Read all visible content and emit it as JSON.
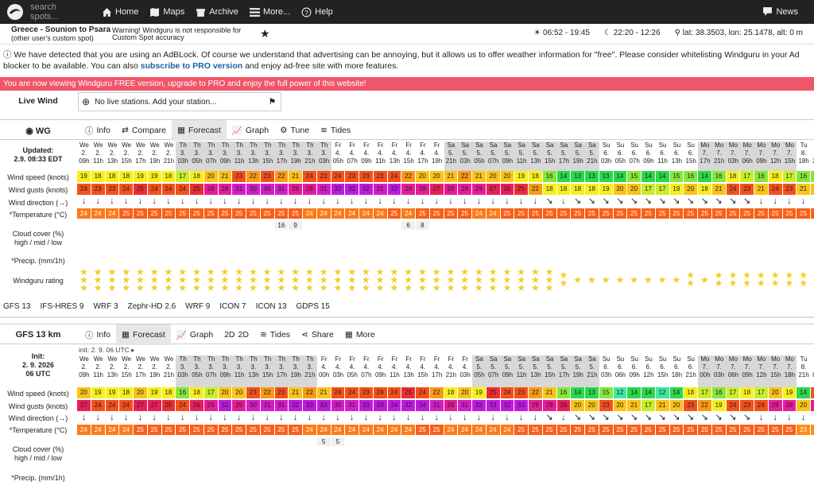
{
  "nav": {
    "search_placeholder": "search spots...",
    "home": "Home",
    "maps": "Maps",
    "archive": "Archive",
    "more": "More...",
    "help": "Help",
    "news": "News"
  },
  "spot": {
    "name": "Greece - Sounion to Psara",
    "note": "(other user's custom spot)",
    "warning": "Warning! Windguru is not responsible for Custom Spot accuracy",
    "sun": "06:52 - 19:45",
    "moon": "22:20 - 12:26",
    "coords": "lat: 38.3503, lon: 25.1478, alt: 0 m"
  },
  "adblock": {
    "text1": "We have detected that you are using an AdBLock. Of course we understand that advertising can be annoying, but it allows us to offer weather information for \"free\". Please consider whitelisting Windguru in your Ad blocker to be available. You can also ",
    "link": "subscribe to PRO version",
    "text2": " and enjoy ad-free site with more features."
  },
  "pro_banner": "You are now viewing Windguru FREE version, upgrade to PRO and enjoy the full power of this website!",
  "livewind": {
    "label": "Live Wind",
    "text": "No live stations. Add your station..."
  },
  "wg": {
    "title": "WG",
    "tabs": [
      "Info",
      "Compare",
      "Forecast",
      "Graph",
      "Tune",
      "Tides"
    ],
    "updated_label": "Updated:",
    "updated_value": "2.9. 08:33 EDT",
    "labels": {
      "speed": "Wind speed (knots)",
      "gusts": "Wind gusts (knots)",
      "dir": "Wind direction (→)",
      "temp": "*Temperature (°C)",
      "cloud": "Cloud cover (%)",
      "cloud2": "high / mid / low",
      "precip": "*Precip. (mm/1h)",
      "rating": "Windguru rating"
    },
    "days": [
      "We",
      "We",
      "We",
      "We",
      "We",
      "We",
      "We",
      "Th",
      "Th",
      "Th",
      "Th",
      "Th",
      "Th",
      "Th",
      "Th",
      "Th",
      "Th",
      "Th",
      "Fr",
      "Fr",
      "Fr",
      "Fr",
      "Fr",
      "Fr",
      "Fr",
      "Fr",
      "Sa",
      "Sa",
      "Sa",
      "Sa",
      "Sa",
      "Sa",
      "Sa",
      "Sa",
      "Sa",
      "Sa",
      "Sa",
      "Su",
      "Su",
      "Su",
      "Su",
      "Su",
      "Su",
      "Su",
      "Mo",
      "Mo",
      "Mo",
      "Mo",
      "Mo",
      "Mo",
      "Mo",
      "Tu",
      "Tu"
    ],
    "dates": [
      "2.",
      "2.",
      "2.",
      "2.",
      "2.",
      "2.",
      "2.",
      "3.",
      "3.",
      "3.",
      "3.",
      "3.",
      "3.",
      "3.",
      "3.",
      "3.",
      "3.",
      "3.",
      "4.",
      "4.",
      "4.",
      "4.",
      "4.",
      "4.",
      "4.",
      "4.",
      "5.",
      "5.",
      "5.",
      "5.",
      "5.",
      "5.",
      "5.",
      "5.",
      "5.",
      "5.",
      "5.",
      "6.",
      "6.",
      "6.",
      "6.",
      "6.",
      "6.",
      "6.",
      "7.",
      "7.",
      "7.",
      "7.",
      "7.",
      "7.",
      "7.",
      "8.",
      "8."
    ],
    "hours": [
      "09h",
      "11h",
      "13h",
      "15h",
      "17h",
      "19h",
      "21h",
      "03h",
      "05h",
      "07h",
      "09h",
      "11h",
      "13h",
      "15h",
      "17h",
      "19h",
      "21h",
      "03h",
      "05h",
      "07h",
      "09h",
      "11h",
      "13h",
      "15h",
      "17h",
      "19h",
      "21h",
      "03h",
      "05h",
      "07h",
      "09h",
      "11h",
      "13h",
      "15h",
      "17h",
      "19h",
      "21h",
      "03h",
      "05h",
      "07h",
      "09h",
      "11h",
      "13h",
      "15h",
      "17h",
      "21h",
      "03h",
      "06h",
      "09h",
      "12h",
      "15h",
      "18h",
      "21h"
    ],
    "speed": [
      19,
      18,
      18,
      18,
      19,
      19,
      18,
      17,
      18,
      20,
      21,
      23,
      22,
      23,
      22,
      21,
      24,
      23,
      24,
      23,
      23,
      23,
      24,
      22,
      20,
      20,
      21,
      22,
      21,
      20,
      20,
      19,
      18,
      16,
      14,
      13,
      13,
      13,
      14,
      15,
      14,
      14,
      15,
      16,
      14,
      16,
      18,
      17,
      16,
      18,
      17,
      16,
      16
    ],
    "gusts": [
      24,
      23,
      23,
      24,
      25,
      24,
      24,
      24,
      25,
      28,
      28,
      31,
      30,
      30,
      31,
      29,
      28,
      31,
      32,
      32,
      32,
      31,
      32,
      29,
      28,
      27,
      28,
      29,
      29,
      27,
      26,
      25,
      22,
      18,
      18,
      18,
      18,
      19,
      20,
      20,
      17,
      17,
      19,
      20,
      18,
      21,
      24,
      23,
      21,
      24,
      23,
      21,
      21
    ],
    "temp": [
      24,
      24,
      24,
      25,
      25,
      25,
      25,
      25,
      25,
      25,
      25,
      25,
      25,
      25,
      25,
      25,
      24,
      24,
      24,
      24,
      24,
      24,
      25,
      24,
      25,
      25,
      25,
      25,
      24,
      24,
      25,
      25,
      25,
      25,
      25,
      25,
      25,
      25,
      25,
      25,
      25,
      25,
      25,
      25,
      25,
      25,
      25,
      25,
      25,
      25,
      25,
      25,
      25
    ],
    "cloud": [
      "",
      "",
      "",
      "",
      "",
      "",
      "",
      "",
      "",
      "",
      "",
      "",
      "",
      "",
      "16",
      "9",
      "",
      "",
      "",
      "",
      "",
      "",
      "",
      "6",
      "8",
      "",
      "",
      "",
      "",
      "",
      "",
      "",
      "",
      "",
      "",
      "",
      "",
      "",
      "",
      "",
      "",
      "",
      "",
      "",
      "",
      "",
      "",
      "",
      "",
      "",
      "",
      "",
      ""
    ],
    "rating": [
      3,
      3,
      3,
      3,
      3,
      3,
      3,
      3,
      3,
      3,
      3,
      3,
      3,
      3,
      3,
      3,
      3,
      3,
      3,
      3,
      3,
      3,
      3,
      3,
      3,
      3,
      3,
      3,
      3,
      3,
      3,
      3,
      3,
      3,
      2,
      1,
      1,
      1,
      1,
      1,
      1,
      1,
      1,
      2,
      1,
      2,
      2,
      2,
      2,
      2,
      2,
      2,
      2
    ]
  },
  "models": [
    "GFS 13",
    "IFS-HRES 9",
    "WRF 3",
    "Zephr-HD 2.6",
    "WRF 9",
    "ICON 7",
    "ICON 13",
    "GDPS 15"
  ],
  "gfs": {
    "title": "GFS 13 km",
    "tabs": [
      "Info",
      "Forecast",
      "Graph",
      "2D",
      "Tides",
      "Share",
      "More"
    ],
    "init_label": "Init:",
    "init_date": "2. 9. 2026",
    "init_time": "06 UTC",
    "init_line": "init: 2. 9. 06 UTC",
    "labels": {
      "speed": "Wind speed (knots)",
      "gusts": "Wind gusts (knots)",
      "dir": "Wind direction (→)",
      "temp": "*Temperature (°C)",
      "cloud": "Cloud cover (%)",
      "cloud2": "high / mid / low",
      "precip": "*Precip. (mm/1h)"
    },
    "days": [
      "We",
      "We",
      "We",
      "We",
      "We",
      "We",
      "We",
      "Th",
      "Th",
      "Th",
      "Th",
      "Th",
      "Th",
      "Th",
      "Th",
      "Th",
      "Th",
      "Fr",
      "Fr",
      "Fr",
      "Fr",
      "Fr",
      "Fr",
      "Fr",
      "Fr",
      "Fr",
      "Fr",
      "Fr",
      "Sa",
      "Sa",
      "Sa",
      "Sa",
      "Sa",
      "Sa",
      "Sa",
      "Sa",
      "Sa",
      "Su",
      "Su",
      "Su",
      "Su",
      "Su",
      "Su",
      "Su",
      "Mo",
      "Mo",
      "Mo",
      "Mo",
      "Mo",
      "Mo",
      "Mo",
      "Tu",
      "Tu"
    ],
    "dates": [
      "2.",
      "2.",
      "2.",
      "2.",
      "2.",
      "2.",
      "2.",
      "3.",
      "3.",
      "3.",
      "3.",
      "3.",
      "3.",
      "3.",
      "3.",
      "3.",
      "3.",
      "4.",
      "4.",
      "4.",
      "4.",
      "4.",
      "4.",
      "4.",
      "4.",
      "4.",
      "4.",
      "4.",
      "5.",
      "5.",
      "5.",
      "5.",
      "5.",
      "5.",
      "5.",
      "5.",
      "5.",
      "6.",
      "6.",
      "6.",
      "6.",
      "6.",
      "6.",
      "6.",
      "7.",
      "7.",
      "7.",
      "7.",
      "7.",
      "7.",
      "7.",
      "8.",
      "8."
    ],
    "hours": [
      "09h",
      "11h",
      "13h",
      "15h",
      "17h",
      "19h",
      "21h",
      "03h",
      "05h",
      "07h",
      "09h",
      "11h",
      "13h",
      "15h",
      "17h",
      "19h",
      "21h",
      "00h",
      "03h",
      "05h",
      "07h",
      "09h",
      "11h",
      "13h",
      "15h",
      "17h",
      "21h",
      "03h",
      "05h",
      "07h",
      "09h",
      "11h",
      "13h",
      "15h",
      "17h",
      "19h",
      "21h",
      "03h",
      "06h",
      "09h",
      "12h",
      "15h",
      "18h",
      "21h",
      "00h",
      "03h",
      "06h",
      "09h",
      "12h",
      "15h",
      "18h",
      "21h",
      "00h"
    ],
    "speed": [
      20,
      19,
      19,
      18,
      20,
      19,
      18,
      16,
      18,
      17,
      20,
      20,
      23,
      22,
      23,
      21,
      22,
      21,
      24,
      24,
      23,
      24,
      24,
      25,
      24,
      22,
      18,
      20,
      19,
      25,
      24,
      23,
      22,
      21,
      16,
      14,
      13,
      15,
      12,
      14,
      14,
      12,
      14,
      18,
      17,
      16,
      17,
      18,
      17,
      20,
      19,
      14,
      23
    ],
    "gusts": [
      27,
      24,
      24,
      24,
      27,
      27,
      25,
      24,
      26,
      29,
      32,
      29,
      30,
      31,
      31,
      32,
      33,
      33,
      30,
      31,
      33,
      33,
      34,
      32,
      34,
      31,
      28,
      31,
      32,
      33,
      32,
      33,
      29,
      28,
      26,
      20,
      20,
      23,
      20,
      21,
      17,
      21,
      20,
      23,
      22,
      19,
      24,
      23,
      24,
      29,
      28,
      20,
      28
    ],
    "temp": [
      24,
      24,
      24,
      24,
      25,
      25,
      25,
      25,
      25,
      25,
      25,
      25,
      25,
      25,
      25,
      25,
      24,
      24,
      24,
      24,
      24,
      24,
      24,
      24,
      25,
      25,
      24,
      24,
      24,
      24,
      24,
      25,
      25,
      25,
      25,
      25,
      25,
      25,
      25,
      25,
      25,
      25,
      25,
      25,
      25,
      25,
      25,
      25,
      25,
      25,
      25,
      23,
      23
    ],
    "cloud": [
      "",
      "",
      "",
      "",
      "",
      "",
      "",
      "",
      "",
      "",
      "",
      "",
      "",
      "",
      "",
      "",
      "",
      "5",
      "5",
      "",
      "",
      "",
      "",
      "",
      "",
      "",
      "",
      "",
      "",
      "",
      "",
      "",
      "",
      "",
      "",
      "",
      "",
      "",
      "",
      "",
      "",
      "",
      "",
      "",
      "",
      "",
      "",
      "",
      "",
      "",
      "",
      "",
      ""
    ]
  }
}
